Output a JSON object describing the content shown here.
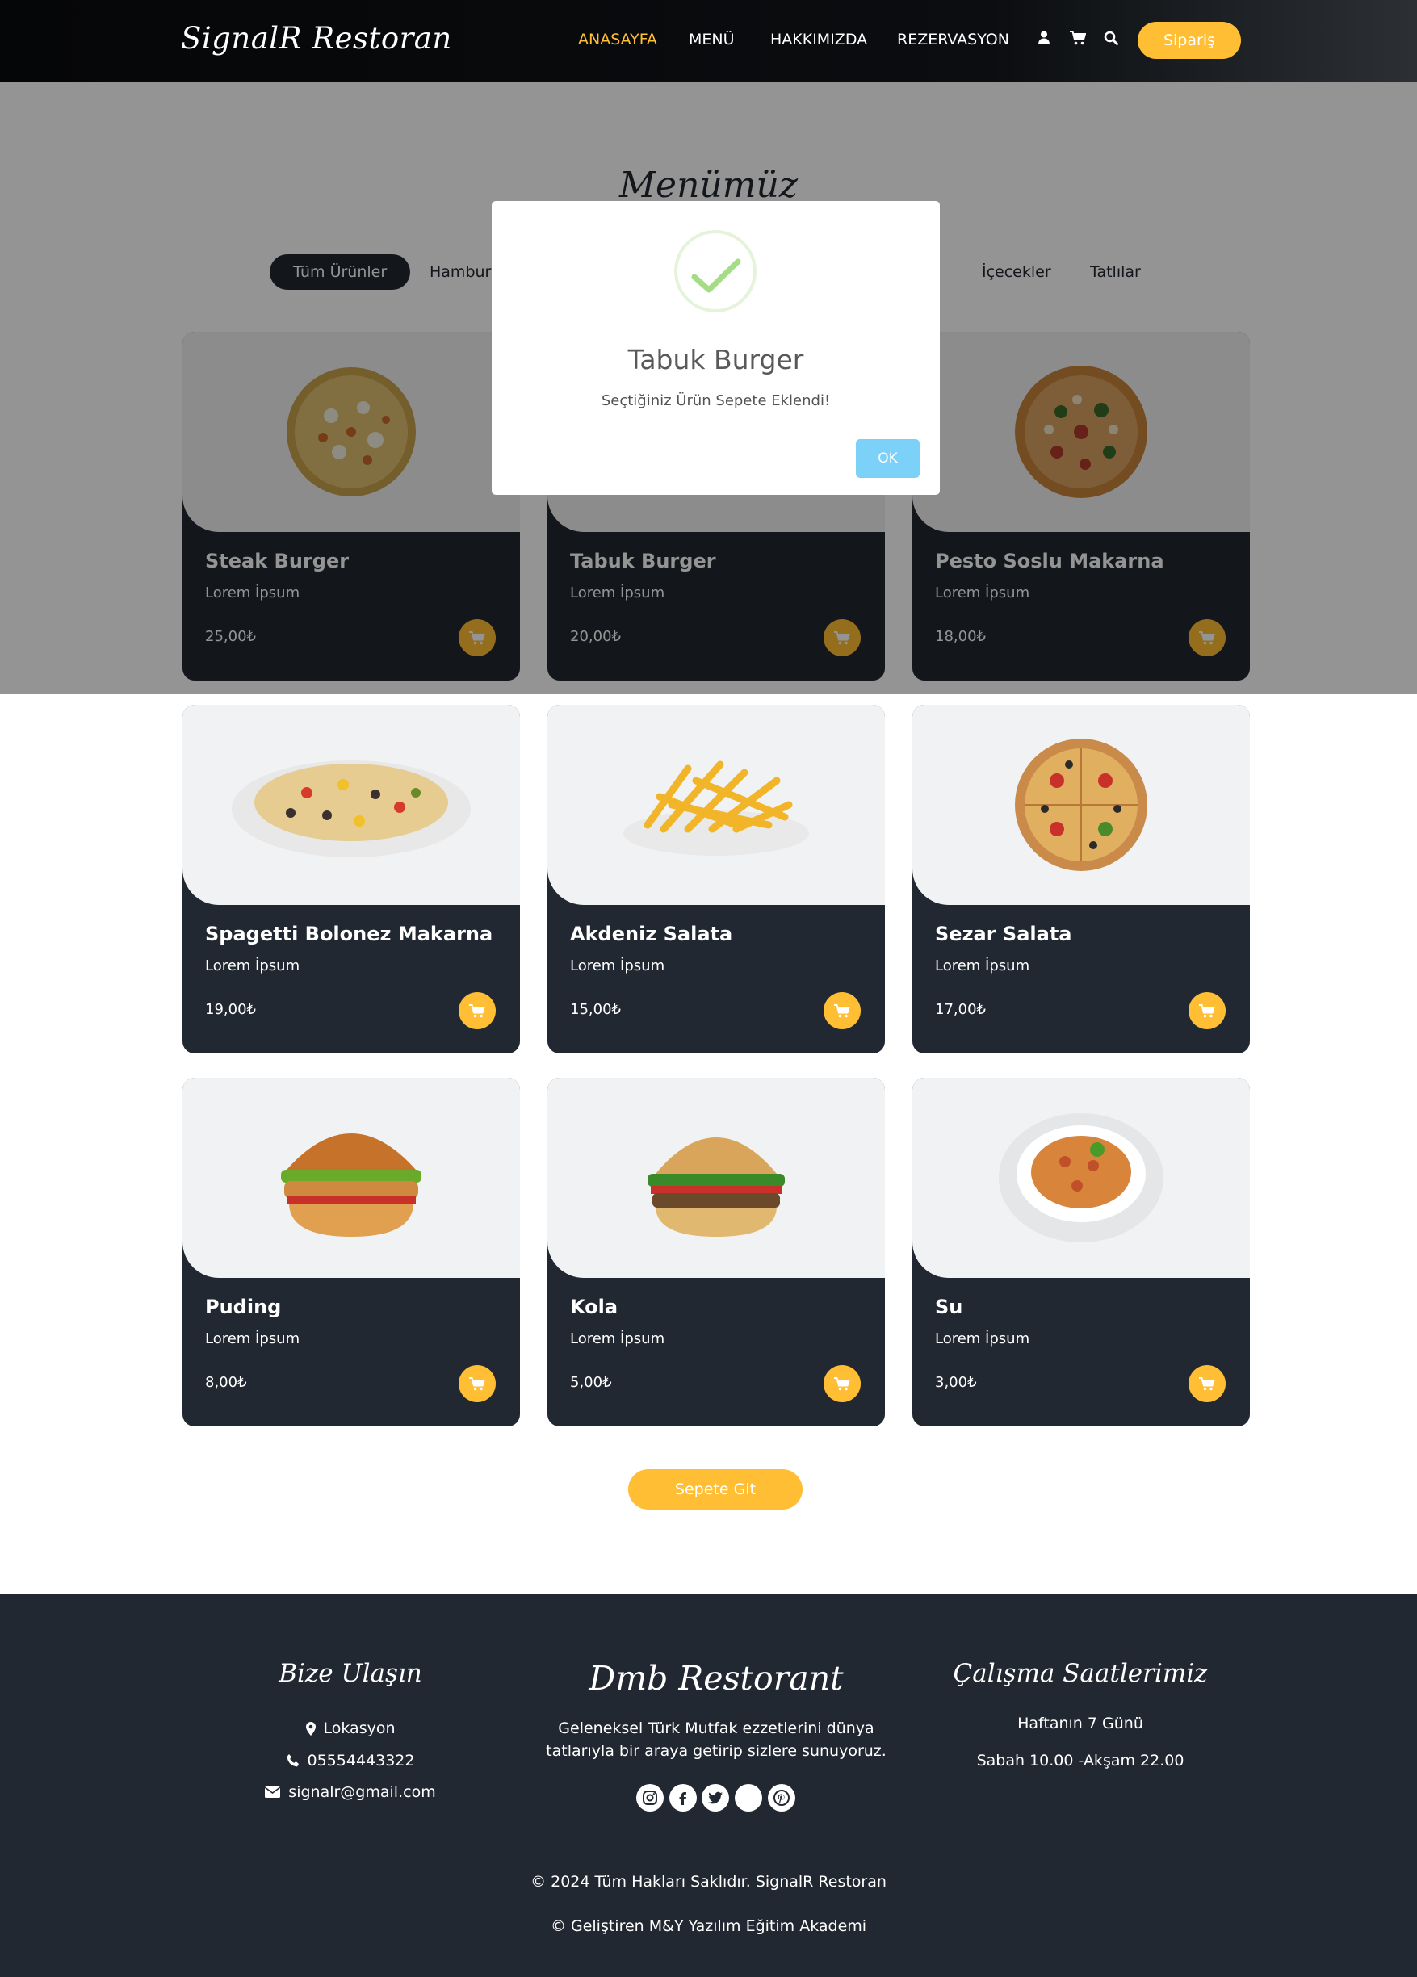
{
  "header": {
    "brand": "SignalR Restoran",
    "nav": [
      "ANASAYFA",
      "MENÜ",
      "HAKKIMIZDA",
      "REZERVASYON"
    ],
    "order_button": "Sipariş"
  },
  "menu": {
    "title": "Menümüz",
    "filters": [
      "Tüm Ürünler",
      "Hamburg",
      "İçecekler",
      "Tatlılar"
    ],
    "products": [
      {
        "name": "Steak Burger",
        "desc": "Lorem İpsum",
        "price": "25,00₺"
      },
      {
        "name": "Tabuk Burger",
        "desc": "Lorem İpsum",
        "price": "20,00₺"
      },
      {
        "name": "Pesto Soslu Makarna",
        "desc": "Lorem İpsum",
        "price": "18,00₺"
      },
      {
        "name": "Spagetti Bolonez Makarna",
        "desc": "Lorem İpsum",
        "price": "19,00₺"
      },
      {
        "name": "Akdeniz Salata",
        "desc": "Lorem İpsum",
        "price": "15,00₺"
      },
      {
        "name": "Sezar Salata",
        "desc": "Lorem İpsum",
        "price": "17,00₺"
      },
      {
        "name": "Puding",
        "desc": "Lorem İpsum",
        "price": "8,00₺"
      },
      {
        "name": "Kola",
        "desc": "Lorem İpsum",
        "price": "5,00₺"
      },
      {
        "name": "Su",
        "desc": "Lorem İpsum",
        "price": "3,00₺"
      }
    ],
    "go_cart": "Sepete Git"
  },
  "modal": {
    "title": "Tabuk Burger",
    "text": "Seçtiğiniz Ürün Sepete Eklendi!",
    "ok": "OK"
  },
  "footer": {
    "contact_title": "Bize Ulaşın",
    "location": "Lokasyon",
    "phone": "05554443322",
    "email": "signalr@gmail.com",
    "brand": "Dmb Restorant",
    "about_line1": "Geleneksel Türk Mutfak ezzetlerini dünya",
    "about_line2": "tatlarıyla bir araya getirip sizlere sunuyoruz.",
    "hours_title": "Çalışma Saatlerimiz",
    "hours_days": "Haftanın 7 Günü",
    "hours_time": "Sabah 10.00 -Akşam 22.00",
    "copyright": "© 2024 Tüm Hakları Saklıdır. SignalR Restoran",
    "developer": "© Geliştiren M&Y Yazılım Eğitim Akademi"
  },
  "colors": {
    "accent": "#ffbe33",
    "dark": "#222831",
    "ok_button": "#7cd1f9",
    "check": "#a5dc86"
  },
  "icons": [
    "user-icon",
    "cart-icon",
    "search-icon",
    "check-icon",
    "map-marker-icon",
    "phone-icon",
    "envelope-icon",
    "instagram-icon",
    "facebook-icon",
    "twitter-icon",
    "pinterest-icon"
  ]
}
